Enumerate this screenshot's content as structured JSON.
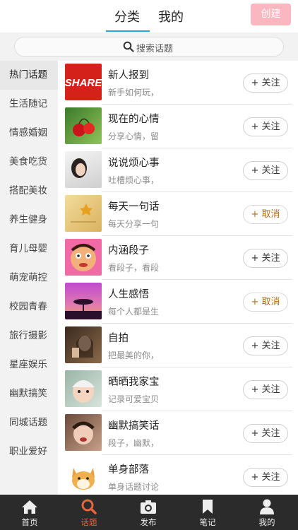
{
  "header": {
    "tabs": [
      "分类",
      "我的"
    ],
    "create_label": "创建"
  },
  "search": {
    "placeholder": "搜索话题"
  },
  "sidebar": {
    "items": [
      "热门话题",
      "生活随记",
      "情感婚姻",
      "美食吃货",
      "搭配美妆",
      "养生健身",
      "育儿母婴",
      "萌宠萌控",
      "校园青春",
      "旅行摄影",
      "星座娱乐",
      "幽默搞笑",
      "同城话题",
      "职业爱好"
    ],
    "active_index": 0
  },
  "topics": [
    {
      "title": "新人报到",
      "subtitle": "新手如何玩，",
      "button": "+ 关注",
      "thumb_text": "SHARE"
    },
    {
      "title": "现在的心情",
      "subtitle": "分享心情，留",
      "button": "+ 关注"
    },
    {
      "title": "说说烦心事",
      "subtitle": "吐槽烦心事，",
      "button": "+ 关注"
    },
    {
      "title": "每天一句话",
      "subtitle": "每天分享一句",
      "button": "+ 取消"
    },
    {
      "title": "内涵段子",
      "subtitle": "看段子，看段",
      "button": "+ 关注"
    },
    {
      "title": "人生感悟",
      "subtitle": "每个人都是生",
      "button": "+ 取消"
    },
    {
      "title": "自拍",
      "subtitle": "把最美的你，",
      "button": "+ 关注"
    },
    {
      "title": "晒晒我家宝",
      "subtitle": "记录可爱宝贝",
      "button": "+ 关注"
    },
    {
      "title": "幽默搞笑话",
      "subtitle": "段子，幽默，",
      "button": "+ 关注"
    },
    {
      "title": "单身部落",
      "subtitle": "单身话题讨论",
      "button": "+ 关注"
    }
  ],
  "tabbar": {
    "items": [
      "首页",
      "话题",
      "发布",
      "笔记",
      "我的"
    ],
    "active_index": 1
  },
  "colors": {
    "accent_blue": "#2aa5d9",
    "create_pink": "#fbb7c0",
    "active_orange": "#e8643c",
    "cancel_brown": "#b36b1a",
    "tabbar_bg": "#2b2b2b"
  }
}
